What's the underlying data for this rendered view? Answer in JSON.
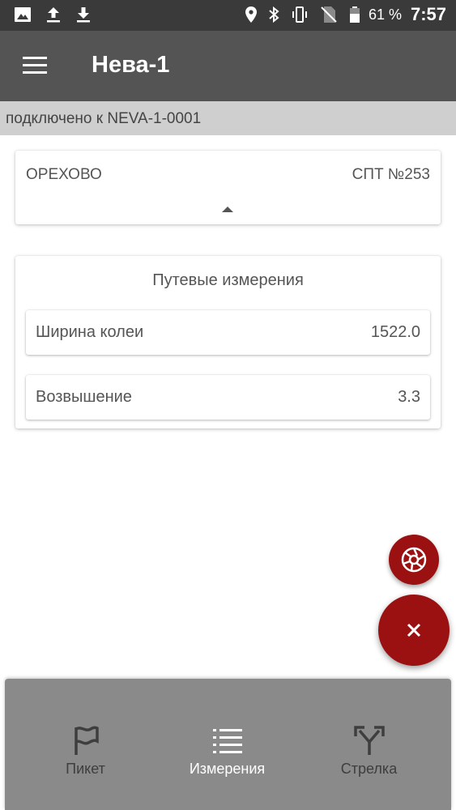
{
  "status_bar": {
    "battery_percent": "61 %",
    "time": "7:57",
    "icons": [
      "image-icon",
      "upload-icon",
      "download-icon",
      "location-icon",
      "bluetooth-icon",
      "vibrate-icon",
      "no-sim-icon",
      "battery-icon"
    ]
  },
  "app_bar": {
    "title": "Нева-1",
    "menu_icon": "hamburger-menu-icon"
  },
  "connection": {
    "text": "подключено к NEVA-1-0001"
  },
  "station": {
    "name": "ОРЕХОВО",
    "switch_post": "СПТ №253",
    "collapse_icon": "triangle-up-icon"
  },
  "measurements": {
    "title": "Путевые измерения",
    "rows": [
      {
        "label": "Ширина колеи",
        "value": "1522.0"
      },
      {
        "label": "Возвышение",
        "value": "3.3"
      }
    ]
  },
  "fabs": {
    "camera_icon": "camera-aperture-icon",
    "close_icon": "close-icon"
  },
  "bottom_nav": {
    "items": [
      {
        "label": "Пикет",
        "icon": "flag-icon",
        "active": false
      },
      {
        "label": "Измерения",
        "icon": "list-icon",
        "active": true
      },
      {
        "label": "Стрелка",
        "icon": "fork-arrows-icon",
        "active": false
      }
    ]
  },
  "colors": {
    "status_bar": "#3a3a3a",
    "app_bar": "#545454",
    "accent": "#9b1010",
    "bottom_nav": "#8a8a8a"
  }
}
